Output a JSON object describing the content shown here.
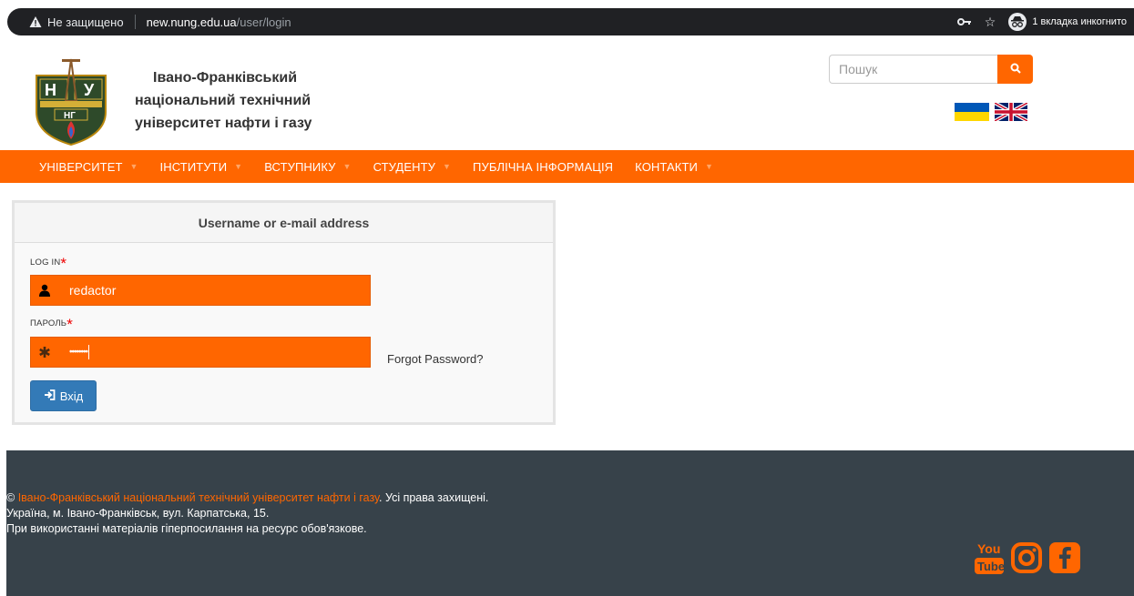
{
  "browser": {
    "security_label": "Не защищено",
    "url_host": "new.nung.edu.ua",
    "url_path": "/user/login",
    "incognito_label": "1 вкладка инкогнито"
  },
  "header": {
    "name_line1": "Івано-Франківський",
    "name_line2": "національний технічний",
    "name_line3": "університет нафти і газу",
    "search_placeholder": "Пошук"
  },
  "nav": {
    "items": [
      {
        "label": "УНІВЕРСИТЕТ"
      },
      {
        "label": "ІНСТИТУТИ"
      },
      {
        "label": "ВСТУПНИКУ"
      },
      {
        "label": "СТУДЕНТУ"
      },
      {
        "label": "ПУБЛІЧНА ІНФОРМАЦІЯ"
      },
      {
        "label": "КОНТАКТИ"
      }
    ]
  },
  "login": {
    "panel_title": "Username or e-mail address",
    "login_label": "LOG IN",
    "login_value": "redactor",
    "password_label": "ПАРОЛЬ",
    "password_value": "••••••••",
    "forgot_label": "Forgot Password?",
    "submit_label": "Вхід"
  },
  "footer": {
    "copyright_symbol": "©",
    "copyright_link": "Івано-Франківський національний технічний університет нафти і газу",
    "rights": ". Усі права захищені.",
    "address": "Україна, м. Івано-Франківськ, вул. Карпатська, 15.",
    "notice": "При використанні матеріалів гіперпосилання на ресурс обов'язкове."
  },
  "colors": {
    "accent": "#ff6600",
    "footer_bg": "#37424a",
    "button_blue": "#337ab7"
  }
}
